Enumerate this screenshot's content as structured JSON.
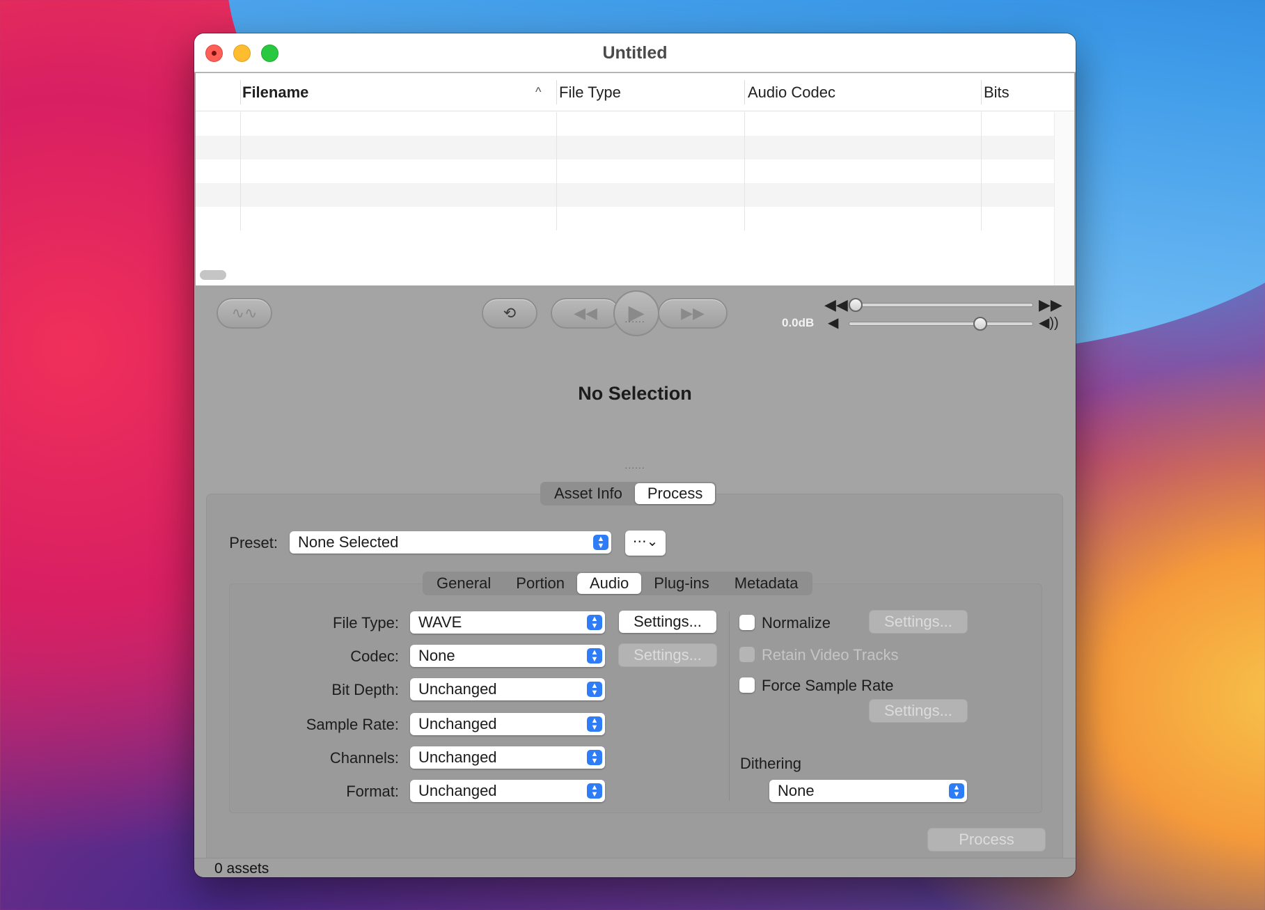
{
  "window": {
    "title": "Untitled"
  },
  "table": {
    "columns": [
      "Filename",
      "File Type",
      "Audio Codec",
      "Bits"
    ],
    "sort_indicator": "^"
  },
  "transport": {
    "volume_label": "0.0dB",
    "position_fraction": 0.0,
    "volume_fraction": 0.73
  },
  "selection": {
    "text": "No Selection"
  },
  "inspector": {
    "tabs": [
      "Asset Info",
      "Process"
    ],
    "active_tab": "Process",
    "preset_label": "Preset:",
    "preset_value": "None Selected",
    "sub_tabs": [
      "General",
      "Portion",
      "Audio",
      "Plug-ins",
      "Metadata"
    ],
    "active_sub_tab": "Audio",
    "fields": {
      "file_type": {
        "label": "File Type:",
        "value": "WAVE"
      },
      "codec": {
        "label": "Codec:",
        "value": "None"
      },
      "bit_depth": {
        "label": "Bit Depth:",
        "value": "Unchanged"
      },
      "sample_rate": {
        "label": "Sample Rate:",
        "value": "Unchanged"
      },
      "channels": {
        "label": "Channels:",
        "value": "Unchanged"
      },
      "format": {
        "label": "Format:",
        "value": "Unchanged"
      }
    },
    "settings_label": "Settings...",
    "normalize": {
      "label": "Normalize",
      "checked": false
    },
    "retain_video": {
      "label": "Retain Video Tracks",
      "checked": false,
      "disabled": true
    },
    "force_sample_rate": {
      "label": "Force Sample Rate",
      "checked": false
    },
    "dithering": {
      "label": "Dithering",
      "value": "None"
    },
    "process_button": "Process"
  },
  "status": {
    "text": "0 assets"
  }
}
